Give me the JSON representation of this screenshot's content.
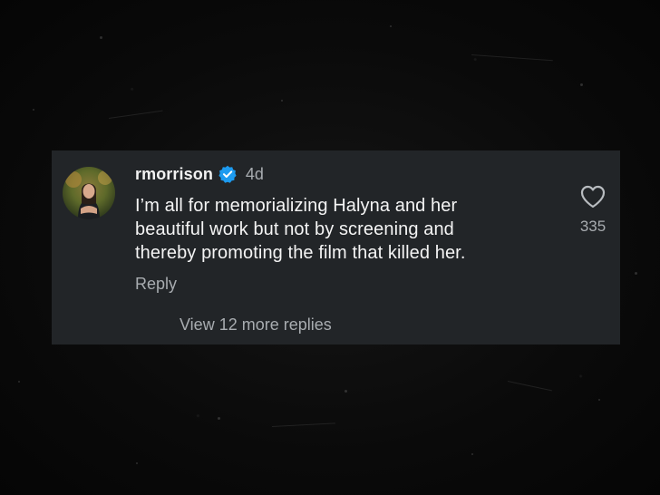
{
  "comment": {
    "username": "rmorrison",
    "verified": true,
    "timestamp": "4d",
    "text_lines": [
      "I’m all for memorializing Halyna and her",
      "beautiful work but not by screening and",
      "thereby promoting the film that killed her."
    ],
    "reply_label": "Reply",
    "like_count": "335",
    "view_replies_label": "View 12 more replies"
  },
  "icons": {
    "verified": "verified-badge-icon",
    "like": "heart-outline-icon"
  },
  "colors": {
    "card_background": "#222528",
    "verified_blue": "#1d9bf0",
    "muted_text": "#a8acb0",
    "primary_text": "#f2f2f2",
    "page_background": "#080808"
  }
}
